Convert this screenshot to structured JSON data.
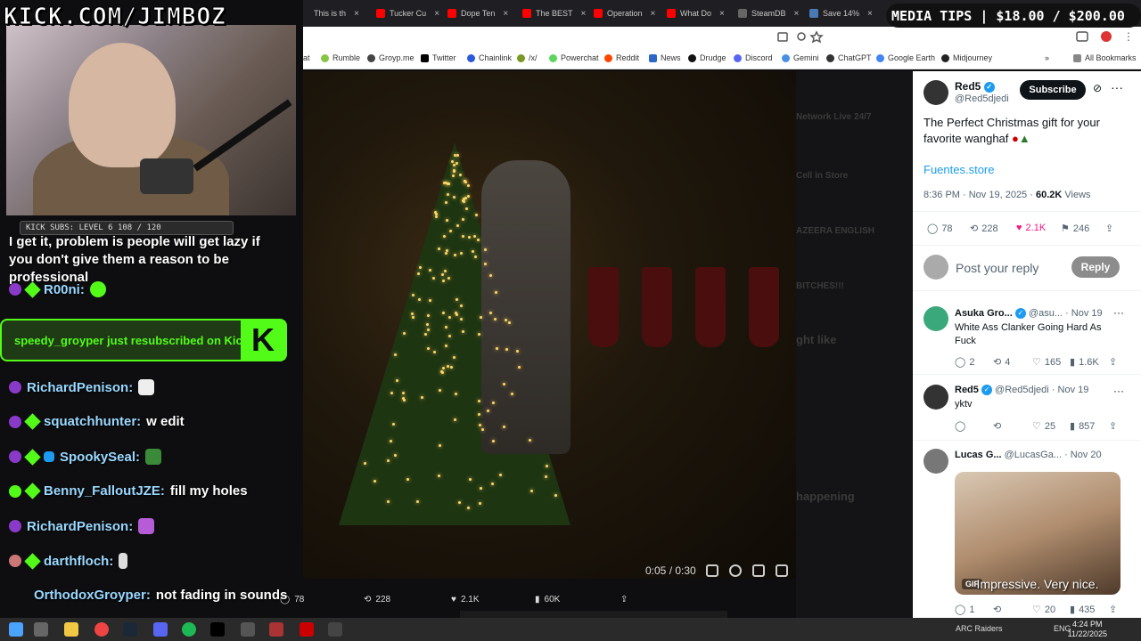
{
  "overlay": {
    "kick_url": "KICK.COM/JIMBOZ",
    "media_tips": "MEDIA TIPS | $18.00 / $200.00",
    "sub_bar": "KICK SUBS: LEVEL 6 108 / 120"
  },
  "browser": {
    "tabs": [
      {
        "label": "This is th",
        "color": "#999"
      },
      {
        "label": "Tucker Cu",
        "color": "#ff0000"
      },
      {
        "label": "Dope Ten",
        "color": "#ff0000"
      },
      {
        "label": "The BEST",
        "color": "#ff0000"
      },
      {
        "label": "Operation",
        "color": "#ff0000"
      },
      {
        "label": "What Do",
        "color": "#ff0000"
      },
      {
        "label": "SteamDB",
        "color": "#555"
      },
      {
        "label": "Save 14%",
        "color": "#1b2838"
      }
    ],
    "bookmarks": [
      "at",
      "Rumble",
      "Groyp.me",
      "Twitter",
      "Chainlink",
      "/x/",
      "Powerchat",
      "Reddit",
      "News",
      "Drudge",
      "Discord",
      "Gemini",
      "ChatGPT",
      "Google Earth",
      "Midjourney"
    ],
    "all_bookmarks": "All Bookmarks"
  },
  "chat": {
    "partial_message": "I get it, problem is people will get lazy if you don't give them a reason to be professional",
    "messages": [
      {
        "user": "R00ni:",
        "msg": ""
      },
      {
        "user": "RichardPenison:",
        "msg": ""
      },
      {
        "user": "squatchhunter:",
        "msg": "w edit"
      },
      {
        "user": "SpookySeal:",
        "msg": ""
      },
      {
        "user": "Benny_FalloutJZE:",
        "msg": "fill my holes"
      },
      {
        "user": "RichardPenison:",
        "msg": ""
      },
      {
        "user": "darthfloch:",
        "msg": ""
      },
      {
        "user": "OrthodoxGroyper:",
        "msg": "not fading in sounds"
      }
    ],
    "resub": "speedy_groyper just resubscribed on Kick"
  },
  "video": {
    "time": "0:05 / 0:30"
  },
  "tweet_bar": {
    "replies": "78",
    "reposts": "228",
    "likes": "2.1K",
    "views": "60K"
  },
  "dim_column": [
    "Network Live 24/7",
    "Cell in Store",
    "AZEERA ENGLISH",
    "BITCHES!!!",
    "ght like",
    "happening"
  ],
  "twitter": {
    "name": "Red5",
    "handle": "@Red5djedi",
    "subscribe": "Subscribe",
    "text_line1": "The Perfect Christmas gift for your",
    "text_line2": "favorite wanghaf",
    "link": "Fuentes.store",
    "meta_time": "8:36 PM · Nov 19, 2025 · ",
    "meta_views": "60.2K",
    "meta_views_label": " Views",
    "stats": {
      "replies": "78",
      "reposts": "228",
      "likes": "2.1K",
      "bookmarks": "246"
    },
    "reply_placeholder": "Post your reply",
    "reply_button": "Reply",
    "replies": [
      {
        "name": "Asuka Gro...",
        "handle": "@asu...",
        "date": "· Nov 19",
        "text_line1": "White Ass Clanker Going Hard As",
        "text_line2": "Fuck",
        "r": "2",
        "rt": "4",
        "l": "165",
        "v": "1.6K"
      },
      {
        "name": "Red5",
        "handle": "@Red5djedi",
        "date": "· Nov 19",
        "text_line1": "yktv",
        "text_line2": "",
        "r": "",
        "rt": "",
        "l": "25",
        "v": "857"
      },
      {
        "name": "Lucas G...",
        "handle": "@LucasGa...",
        "date": "· Nov 20",
        "gif_caption": "Impressive. Very nice.",
        "gif_badge": "GIF",
        "r": "1",
        "rt": "",
        "l": "20",
        "v": "435"
      }
    ]
  },
  "taskbar": {
    "time": "4:24 PM",
    "date": "11/22/2025",
    "lang": "ENG",
    "app": "ARC Raiders"
  }
}
